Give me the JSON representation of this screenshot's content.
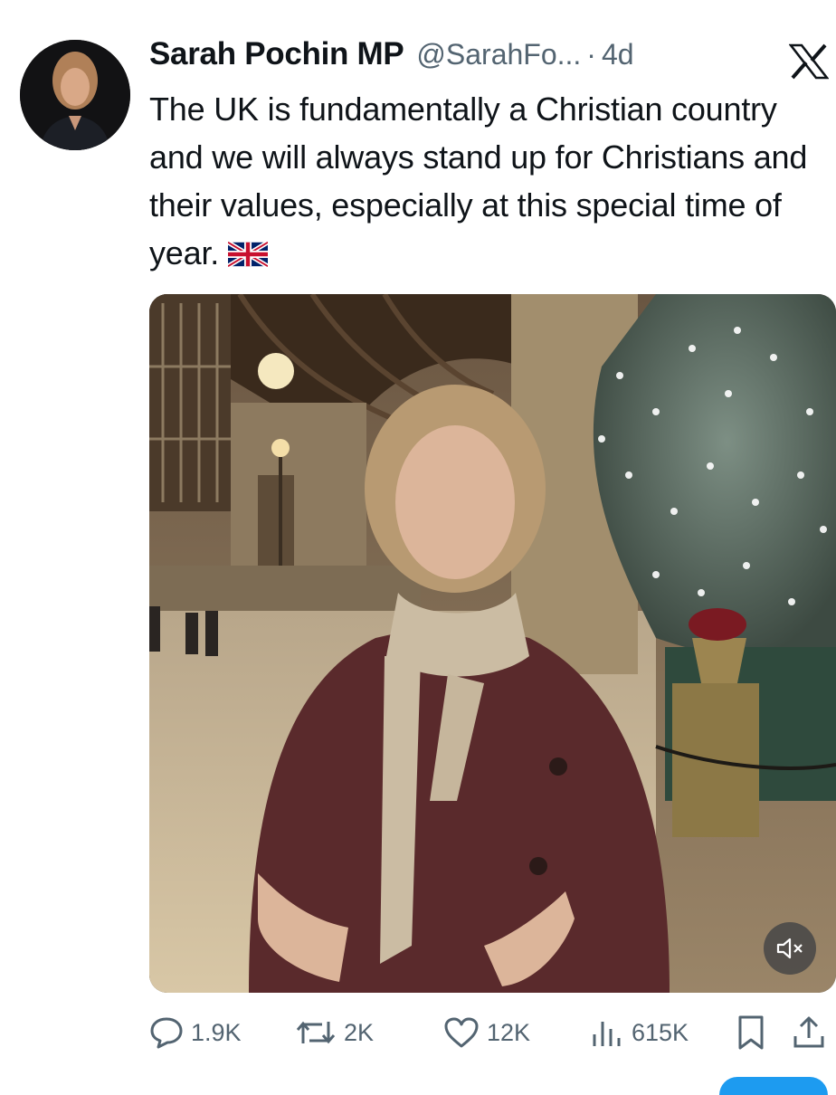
{
  "tweet": {
    "author_name": "Sarah Pochin MP",
    "handle": "@SarahFo...",
    "separator": "·",
    "time": "4d",
    "text": "The UK is fundamentally a Christian country and we will always stand up for Christians and their values, especially at this special time of year.",
    "flag_icon": "uk-flag-icon"
  },
  "actions": {
    "replies": "1.9K",
    "reposts": "2K",
    "likes": "12K",
    "views": "615K"
  },
  "icons": {
    "reply": "speech-bubble-icon",
    "repost": "repost-arrows-icon",
    "like": "heart-icon",
    "views": "bar-chart-icon",
    "bookmark": "bookmark-icon",
    "share": "share-upload-icon",
    "mute": "speaker-muted-icon",
    "platform": "x-logo-icon"
  },
  "colors": {
    "text": "#0f1419",
    "secondary": "#536471",
    "accent": "#1d9bf0"
  }
}
